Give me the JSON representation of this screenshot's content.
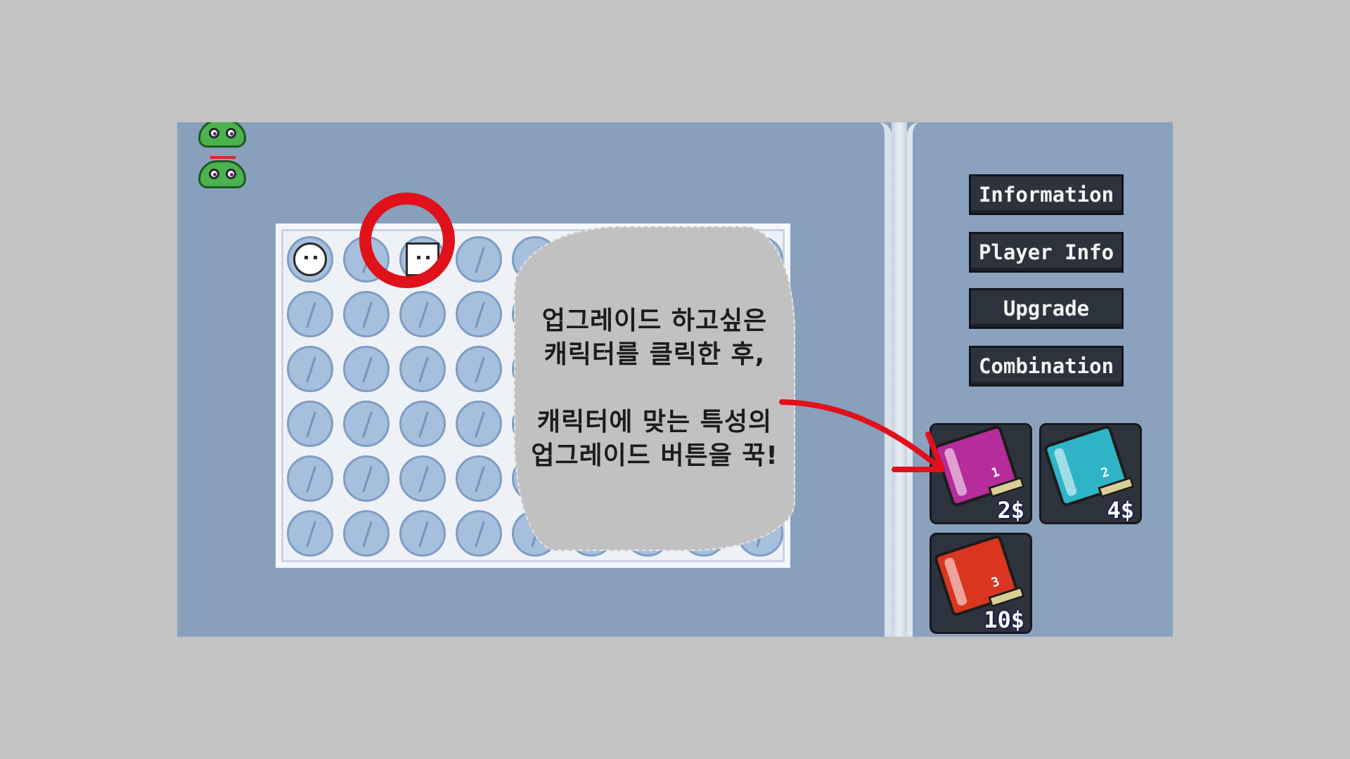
{
  "instruction": {
    "lines": [
      "업그레이드 하고싶은",
      "캐릭터를 클릭한 후,",
      "캐릭터에 맞는 특성의",
      "업그레이드 버튼을 꾹!"
    ]
  },
  "menu": {
    "information": "Information",
    "player_info": "Player Info",
    "upgrade": "Upgrade",
    "combination": "Combination"
  },
  "upgrades": [
    {
      "number": "1",
      "price": "2$",
      "color": "#b52c9a"
    },
    {
      "number": "2",
      "price": "4$",
      "color": "#2fb4c7"
    },
    {
      "number": "3",
      "price": "10$",
      "color": "#d9351f"
    }
  ],
  "colors": {
    "highlight": "#e0111b",
    "note_background": "#c1c1c1",
    "field": "#88a0bc"
  }
}
